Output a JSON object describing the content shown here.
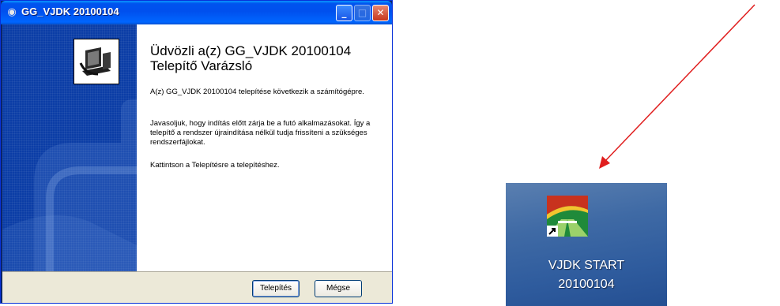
{
  "window": {
    "title": "GG_VJDK 20100104",
    "heading": "Üdvözli a(z) GG_VJDK 20100104 Telepítő Varázsló",
    "paragraphs": [
      "A(z) GG_VJDK 20100104 telepítése következik a számítógépre.",
      "Javasoljuk, hogy indítás előtt zárja be a futó alkalmazásokat. Így a telepítő a rendszer újraindítása nélkül tudja frissíteni a szükséges rendszerfájlokat.",
      "Kattintson a Telepítésre a telepítéshez."
    ],
    "buttons": {
      "install": "Telepítés",
      "cancel": "Mégse"
    },
    "icons": {
      "title": "installer-icon",
      "banner": "computer-install-icon"
    }
  },
  "desktop": {
    "shortcut_line1": "VJDK START",
    "shortcut_line2": "20100104",
    "icon": "vjdk-shortcut-icon"
  },
  "colors": {
    "titlebar": "#0053ee",
    "banner": "#0b3da6",
    "arrow": "#e01e1e"
  }
}
